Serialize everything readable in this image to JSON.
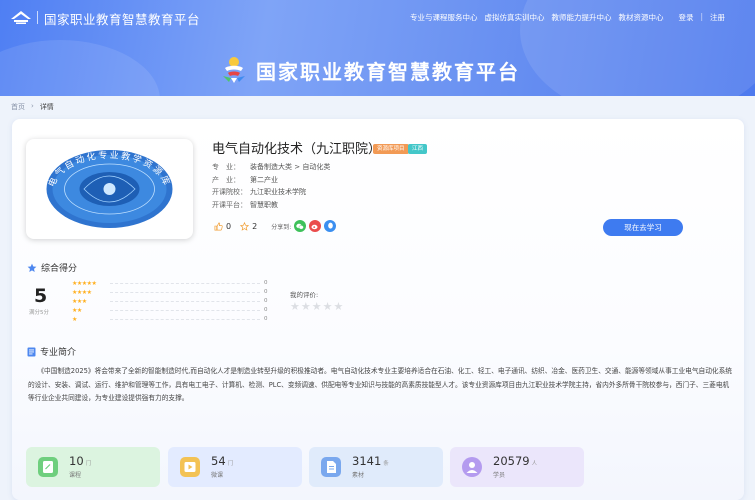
{
  "header": {
    "site_name": "国家职业教育智慧教育平台",
    "hero_title": "国家职业教育智慧教育平台",
    "nav": [
      "专业与课程服务中心",
      "虚拟仿真实训中心",
      "教师能力提升中心",
      "教材资源中心"
    ],
    "login": "登录",
    "nav_sep": "|",
    "register": "注册"
  },
  "breadcrumb": {
    "home": "首页",
    "sep": "›",
    "current": "详情"
  },
  "course": {
    "title": "电气自动化技术（九江职院）",
    "tags": [
      "资源库项目",
      "江西"
    ],
    "meta": [
      {
        "key": "专　业：",
        "value": "装备制造大类 > 自动化类"
      },
      {
        "key": "产　业：",
        "value": "第二产业"
      },
      {
        "key": "开课院校：",
        "value": "九江职业技术学院"
      },
      {
        "key": "开课平台：",
        "value": "智慧职教"
      }
    ],
    "likes": "0",
    "favorites": "2",
    "share_label": "分享到:",
    "study_button": "现在去学习",
    "cover_text": "电气自动化专业教学资源库"
  },
  "rating": {
    "title": "综合得分",
    "score": "5",
    "score_sub": "满分5分",
    "rows": [
      {
        "stars": 5,
        "count": "0"
      },
      {
        "stars": 4,
        "count": "0"
      },
      {
        "stars": 3,
        "count": "0"
      },
      {
        "stars": 2,
        "count": "0"
      },
      {
        "stars": 1,
        "count": "0"
      }
    ],
    "my_rating_label": "我的评价:"
  },
  "intro": {
    "title": "专业简介",
    "text": "《中国制造2025》将会带来了全新的智能制造时代,而自动化人才是制造业转型升级的积极推动者。电气自动化技术专业主要培养适合在石油、化工、轻工、电子通讯、纺织、冶金、医药卫生、交通、能源等领域从事工业电气自动化系统的设计、安装、调试、运行、维护和管理等工作，具有电工电子、计算机、检测、PLC、变频调速、供配电等专业知识与技能的高素质技能型人才。该专业资源库项目由九江职业技术学院主持，省内外多所骨干院校参与，西门子、三菱电机等行业企业共同建设，为专业建设提供强有力的支撑。"
  },
  "stats": [
    {
      "value": "10",
      "unit": "门",
      "label": "课程",
      "bg": "#dcf4e0",
      "icon_bg": "#6fcf7e"
    },
    {
      "value": "54",
      "unit": "门",
      "label": "微课",
      "bg": "#e3ebff",
      "icon_bg": "#f3c254"
    },
    {
      "value": "3141",
      "unit": "条",
      "label": "素材",
      "bg": "#e0ebfb",
      "icon_bg": "#7aa8ee"
    },
    {
      "value": "20579",
      "unit": "人",
      "label": "学员",
      "bg": "#ebe6fb",
      "icon_bg": "#b49bef"
    }
  ],
  "colors": {
    "primary": "#3e7bf0",
    "banner": "#6d94f2",
    "star": "#ffb020"
  }
}
